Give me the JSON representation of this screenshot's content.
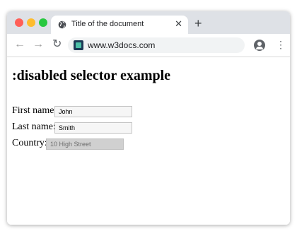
{
  "browser": {
    "tab_title": "Title of the document",
    "tab_close": "✕",
    "new_tab": "+",
    "back": "←",
    "forward": "→",
    "reload": "↻",
    "url": "www.w3docs.com",
    "menu": "⋮"
  },
  "page": {
    "heading": ":disabled selector example",
    "fields": [
      {
        "label": "First name:",
        "value": "John",
        "disabled": false
      },
      {
        "label": "Last name:",
        "value": "Smith",
        "disabled": false
      },
      {
        "label": "Country:",
        "value": "10 High Street",
        "disabled": true
      }
    ]
  },
  "colors": {
    "close_dot": "#ff5f57",
    "minimize_dot": "#febc2e",
    "maximize_dot": "#28c840",
    "titlebar": "#dee1e6",
    "disabled_field": "#d0d0d0"
  }
}
